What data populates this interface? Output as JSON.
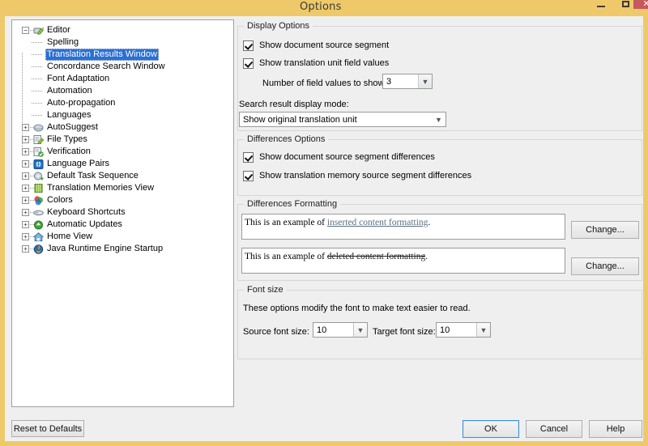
{
  "window": {
    "title": "Options",
    "controls": {
      "minimize": "–",
      "maximize": "□",
      "close": "✕"
    }
  },
  "tree": {
    "nodes": [
      {
        "label": "Editor",
        "icon": "editor-pencil-icon",
        "depth": 0,
        "expander": "-",
        "selected": false
      },
      {
        "label": "Spelling",
        "icon": "none",
        "depth": 1,
        "expander": "",
        "selected": false
      },
      {
        "label": "Translation Results Window",
        "icon": "none",
        "depth": 1,
        "expander": "",
        "selected": true
      },
      {
        "label": "Concordance Search Window",
        "icon": "none",
        "depth": 1,
        "expander": "",
        "selected": false
      },
      {
        "label": "Font Adaptation",
        "icon": "none",
        "depth": 1,
        "expander": "",
        "selected": false
      },
      {
        "label": "Automation",
        "icon": "none",
        "depth": 1,
        "expander": "",
        "selected": false
      },
      {
        "label": "Auto-propagation",
        "icon": "none",
        "depth": 1,
        "expander": "",
        "selected": false
      },
      {
        "label": "Languages",
        "icon": "none",
        "depth": 1,
        "expander": "",
        "selected": false
      },
      {
        "label": "AutoSuggest",
        "icon": "autosuggest-icon",
        "depth": 0,
        "expander": "+",
        "selected": false
      },
      {
        "label": "File Types",
        "icon": "file-types-icon",
        "depth": 0,
        "expander": "+",
        "selected": false
      },
      {
        "label": "Verification",
        "icon": "verification-icon",
        "depth": 0,
        "expander": "+",
        "selected": false
      },
      {
        "label": "Language Pairs",
        "icon": "language-pairs-icon",
        "depth": 0,
        "expander": "+",
        "selected": false
      },
      {
        "label": "Default Task Sequence",
        "icon": "task-sequence-icon",
        "depth": 0,
        "expander": "+",
        "selected": false
      },
      {
        "label": "Translation Memories View",
        "icon": "translation-memories-icon",
        "depth": 0,
        "expander": "+",
        "selected": false
      },
      {
        "label": "Colors",
        "icon": "colors-icon",
        "depth": 0,
        "expander": "+",
        "selected": false
      },
      {
        "label": "Keyboard Shortcuts",
        "icon": "keyboard-icon",
        "depth": 0,
        "expander": "+",
        "selected": false
      },
      {
        "label": "Automatic Updates",
        "icon": "updates-icon",
        "depth": 0,
        "expander": "+",
        "selected": false
      },
      {
        "label": "Home View",
        "icon": "home-icon",
        "depth": 0,
        "expander": "+",
        "selected": false
      },
      {
        "label": "Java Runtime Engine Startup",
        "icon": "java-icon",
        "depth": 0,
        "expander": "+",
        "selected": false
      }
    ]
  },
  "display_options": {
    "title": "Display Options",
    "show_source_segment": {
      "label": "Show document source segment",
      "checked": true
    },
    "show_field_values": {
      "label": "Show translation unit field values",
      "checked": true
    },
    "field_count_label": "Number of field values to show:",
    "field_count_value": "3",
    "search_mode_label": "Search result display mode:",
    "search_mode_value": "Show original translation unit"
  },
  "differences_options": {
    "title": "Differences Options",
    "show_doc_diff": {
      "label": "Show document source segment differences",
      "checked": true
    },
    "show_tm_diff": {
      "label": "Show translation memory source segment differences",
      "checked": true
    }
  },
  "differences_formatting": {
    "title": "Differences Formatting",
    "inserted": {
      "prefix": "This is an example of ",
      "highlight": "inserted content formatting",
      "suffix": "."
    },
    "deleted": {
      "prefix": "This is an example of ",
      "highlight": "deleted content formatting",
      "suffix": "."
    },
    "change_button_1": "Change...",
    "change_button_2": "Change..."
  },
  "font_size": {
    "title": "Font size",
    "description": "These options modify the font to make text easier to read.",
    "source_label": "Source font size:",
    "source_value": "10",
    "target_label": "Target font size:",
    "target_value": "10"
  },
  "footer": {
    "reset": "Reset to Defaults",
    "ok": "OK",
    "cancel": "Cancel",
    "help": "Help"
  },
  "colors": {
    "titlebar": "#efc969",
    "selection": "#2b6fd4",
    "close_button": "#c5595b",
    "inserted_text": "#5b6f84",
    "dialog_bg": "#efefef"
  }
}
